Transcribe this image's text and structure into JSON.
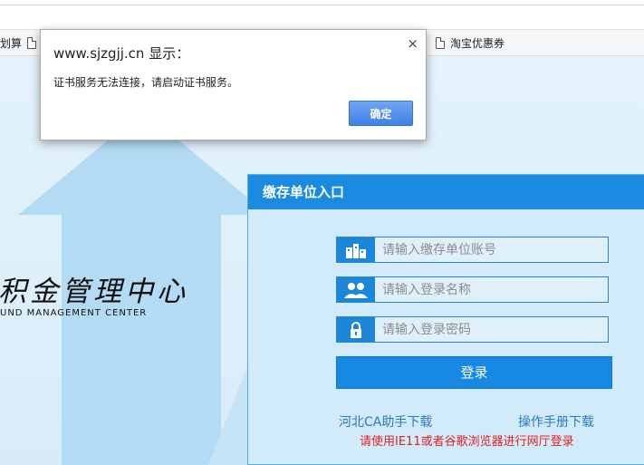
{
  "browser": {
    "bookmarks": [
      {
        "label": "划算"
      },
      {
        "label": "淘宝优惠券"
      }
    ]
  },
  "dialog": {
    "title": "www.sjzgjj.cn 显示：",
    "message": "证书服务无法连接，请启动证书服务。",
    "ok_label": "确定",
    "close_glyph": "×"
  },
  "logo": {
    "cn": "积金管理中心",
    "en": "UND MANAGEMENT CENTER"
  },
  "login": {
    "header": "缴存单位入口",
    "account_placeholder": "请输入缴存单位账号",
    "username_placeholder": "请输入登录名称",
    "password_placeholder": "请输入登录密码",
    "submit_label": "登录",
    "ca_link": "河北CA助手下载",
    "manual_link": "操作手册下载",
    "notice": "请使用IE11或者谷歌浏览器进行网厅登录"
  },
  "colors": {
    "accent": "#1a8be0",
    "notice": "#e0211f",
    "link": "#2b78c7"
  }
}
